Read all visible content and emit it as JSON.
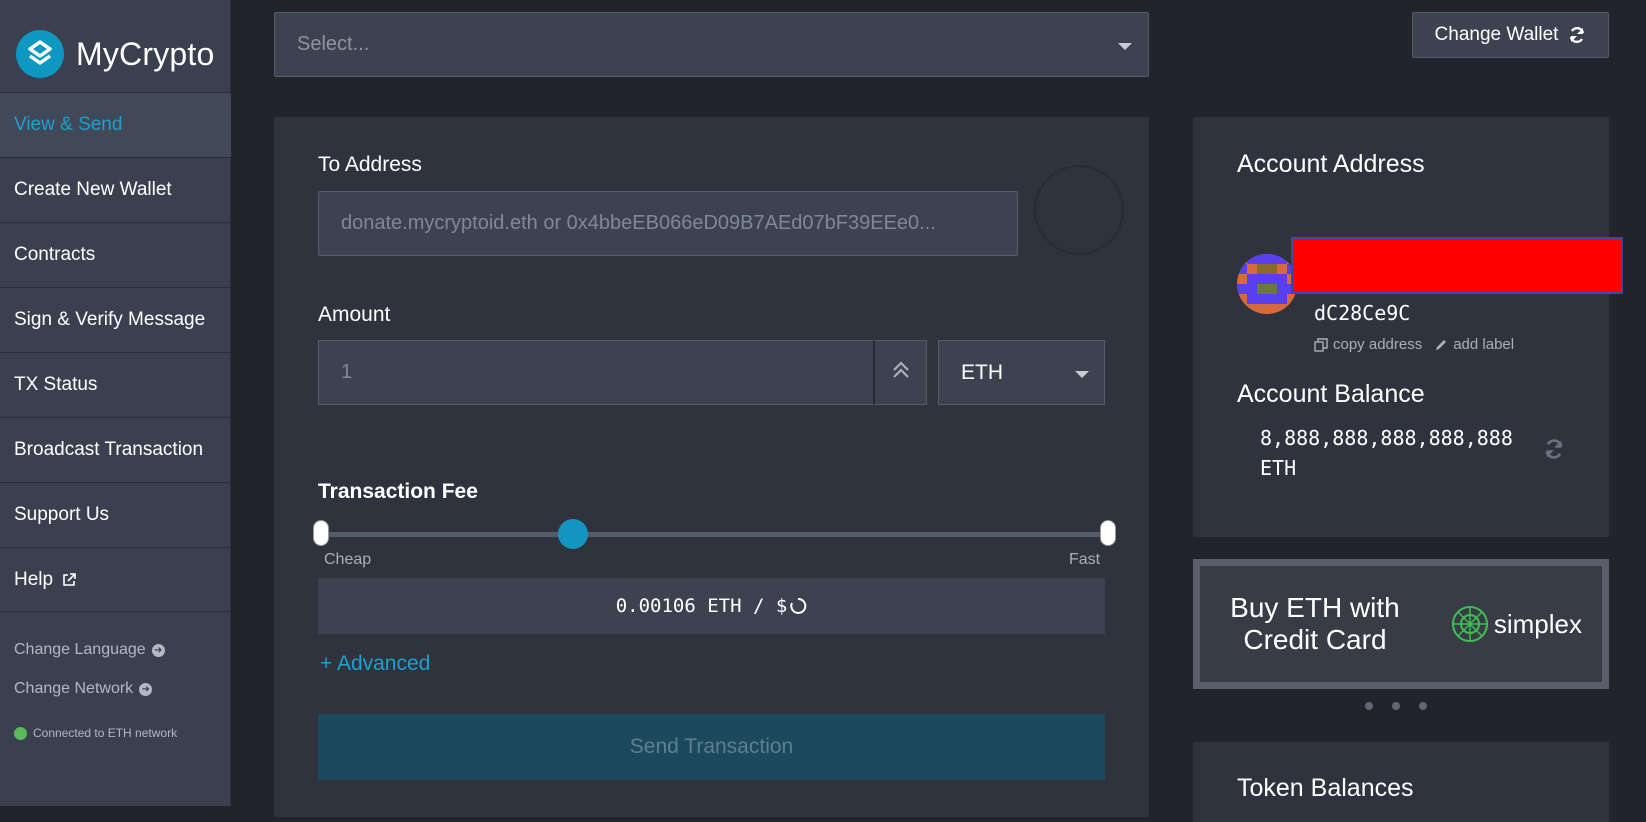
{
  "brand": {
    "name": "MyCrypto"
  },
  "nav": {
    "items": [
      {
        "label": "View & Send"
      },
      {
        "label": "Create New Wallet"
      },
      {
        "label": "Contracts"
      },
      {
        "label": "Sign & Verify Message"
      },
      {
        "label": "TX Status"
      },
      {
        "label": "Broadcast Transaction"
      },
      {
        "label": "Support Us"
      },
      {
        "label": "Help"
      }
    ],
    "active_index": 0,
    "change_language": "Change Language",
    "change_network": "Change Network",
    "status": "Connected to ETH network"
  },
  "wallet": {
    "select_placeholder": "Select...",
    "change_wallet_label": "Change Wallet"
  },
  "send": {
    "to_label": "To Address",
    "to_placeholder": "donate.mycryptoid.eth or 0x4bbeEB066eD09B7AEd07bF39EEe0...",
    "amount_label": "Amount",
    "amount_placeholder": "1",
    "unit": "ETH",
    "fee_title": "Transaction Fee",
    "fee_cheap": "Cheap",
    "fee_fast": "Fast",
    "fee_level": 0.32,
    "fee_value": "0.00106 ETH / $",
    "advanced": "+ Advanced",
    "send_button": "Send Transaction"
  },
  "account": {
    "address_title": "Account Address",
    "address_tail": "dC28Ce9C",
    "copy_address": "copy address",
    "add_label": "add label",
    "balance_title": "Account Balance",
    "balance": "8,888,888,888,888,888 ETH"
  },
  "promo": {
    "text": "Buy ETH with Credit Card",
    "brand": "simplex"
  },
  "tokens": {
    "title": "Token Balances"
  },
  "colors": {
    "accent": "#1ea0cf",
    "background": "#21252b",
    "panel": "#2e333e",
    "sidebar": "#3a4050",
    "connected": "#5dba5a"
  }
}
